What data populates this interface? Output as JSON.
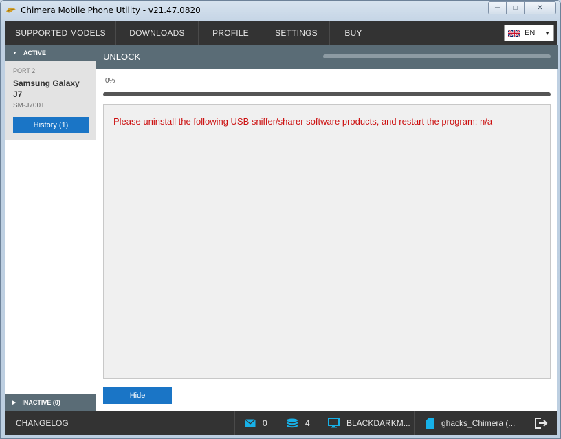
{
  "window": {
    "title": "Chimera Mobile Phone Utility - v21.47.0820",
    "min_glyph": "─",
    "max_glyph": "□",
    "close_glyph": "✕"
  },
  "nav": {
    "items": [
      "SUPPORTED MODELS",
      "DOWNLOADS",
      "PROFILE",
      "SETTINGS",
      "BUY"
    ],
    "language": "EN"
  },
  "sidebar": {
    "active_label": "ACTIVE",
    "device": {
      "port": "PORT 2",
      "name": "Samsung Galaxy J7",
      "model": "SM-J700T",
      "history_label": "History (1)"
    },
    "inactive_label": "INACTIVE (0)"
  },
  "main": {
    "title": "UNLOCK",
    "progress_text": "0%",
    "progress_value": 0,
    "log_message": "Please uninstall the following USB sniffer/sharer software products, and restart the program: n/a",
    "hide_label": "Hide"
  },
  "bottombar": {
    "changelog": "CHANGELOG",
    "messages_count": "0",
    "credits_count": "4",
    "computer_name": "BLACKDARKM...",
    "license_name": "ghacks_Chimera (..."
  },
  "icons": {
    "app": "chimera-logo-icon",
    "messages": "envelope-icon",
    "credits": "coin-stack-icon",
    "computer": "monitor-icon",
    "license": "card-icon",
    "logout": "logout-icon"
  },
  "colors": {
    "accent_blue": "#1a75c6",
    "icon_cyan": "#17b1e8",
    "dark_bar": "#333333",
    "panel_header": "#5a6c76",
    "error_red": "#cc1010"
  }
}
